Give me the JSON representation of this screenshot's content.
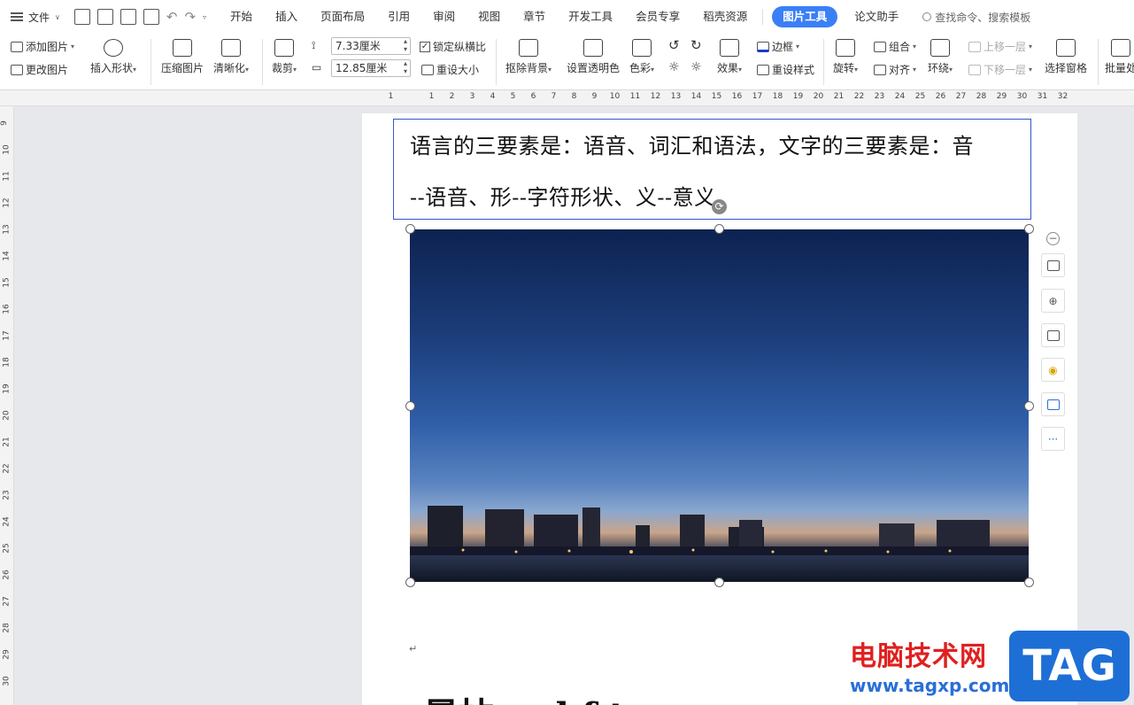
{
  "menubar": {
    "file_label": "文件",
    "tabs": [
      "开始",
      "插入",
      "页面布局",
      "引用",
      "审阅",
      "视图",
      "章节",
      "开发工具",
      "会员专享",
      "稻壳资源"
    ],
    "active_tab": "图片工具",
    "tab_after": "论文助手",
    "search_placeholder": "查找命令、搜索模板"
  },
  "ribbon": {
    "add_picture": "添加图片",
    "change_picture": "更改图片",
    "insert_shape": "插入形状",
    "compress": "压缩图片",
    "sharpen": "清晰化",
    "crop": "裁剪",
    "height_value": "7.33厘米",
    "width_value": "12.85厘米",
    "lock_ratio": "锁定纵横比",
    "reset_size": "重设大小",
    "remove_bg": "抠除背景",
    "set_transparent": "设置透明色",
    "color": "色彩",
    "effects": "效果",
    "border": "边框",
    "reset_style": "重设样式",
    "rotate": "旋转",
    "group": "组合",
    "align": "对齐",
    "wrap": "环绕",
    "bring_forward": "上移一层",
    "send_backward": "下移一层",
    "selection_pane": "选择窗格",
    "batch": "批量处"
  },
  "ruler": {
    "h_numbers": [
      "1",
      "",
      "1",
      "2",
      "3",
      "4",
      "5",
      "6",
      "7",
      "8",
      "9",
      "10",
      "11",
      "12",
      "13",
      "14",
      "15",
      "16",
      "17",
      "18",
      "19",
      "20",
      "21",
      "22",
      "23",
      "24",
      "25",
      "26",
      "27",
      "28",
      "29",
      "30",
      "31",
      "32"
    ],
    "v_numbers": [
      "9",
      "10",
      "11",
      "12",
      "13",
      "14",
      "15",
      "16",
      "17",
      "18",
      "19",
      "20",
      "21",
      "22",
      "23",
      "24",
      "25",
      "26",
      "27",
      "28",
      "29",
      "30"
    ]
  },
  "document": {
    "textbox_line1": "语言的三要素是：语音、词汇和语法，文字的三要素是：音",
    "textbox_line2": "--语音、形--字符形状、义--意义。",
    "paragraph_mark": "↵",
    "heading_partial": "晨拈 ... l f t"
  },
  "watermark": {
    "site_name": "电脑技术网",
    "site_url": "www.tagxp.com",
    "logo_text": "TAG"
  }
}
